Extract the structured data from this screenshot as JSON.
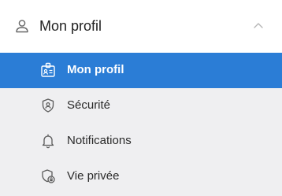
{
  "header": {
    "title": "Mon profil",
    "icon": "user-icon",
    "toggle_icon": "chevron-up-icon"
  },
  "menu": {
    "items": [
      {
        "label": "Mon profil",
        "icon": "id-card-icon",
        "active": true
      },
      {
        "label": "Sécurité",
        "icon": "shield-icon",
        "active": false
      },
      {
        "label": "Notifications",
        "icon": "bell-icon",
        "active": false
      },
      {
        "label": "Vie privée",
        "icon": "privacy-shield-icon",
        "active": false
      }
    ]
  },
  "colors": {
    "active_bg": "#2b7dd6",
    "panel_bg": "#efeff1",
    "header_bg": "#ffffff"
  }
}
